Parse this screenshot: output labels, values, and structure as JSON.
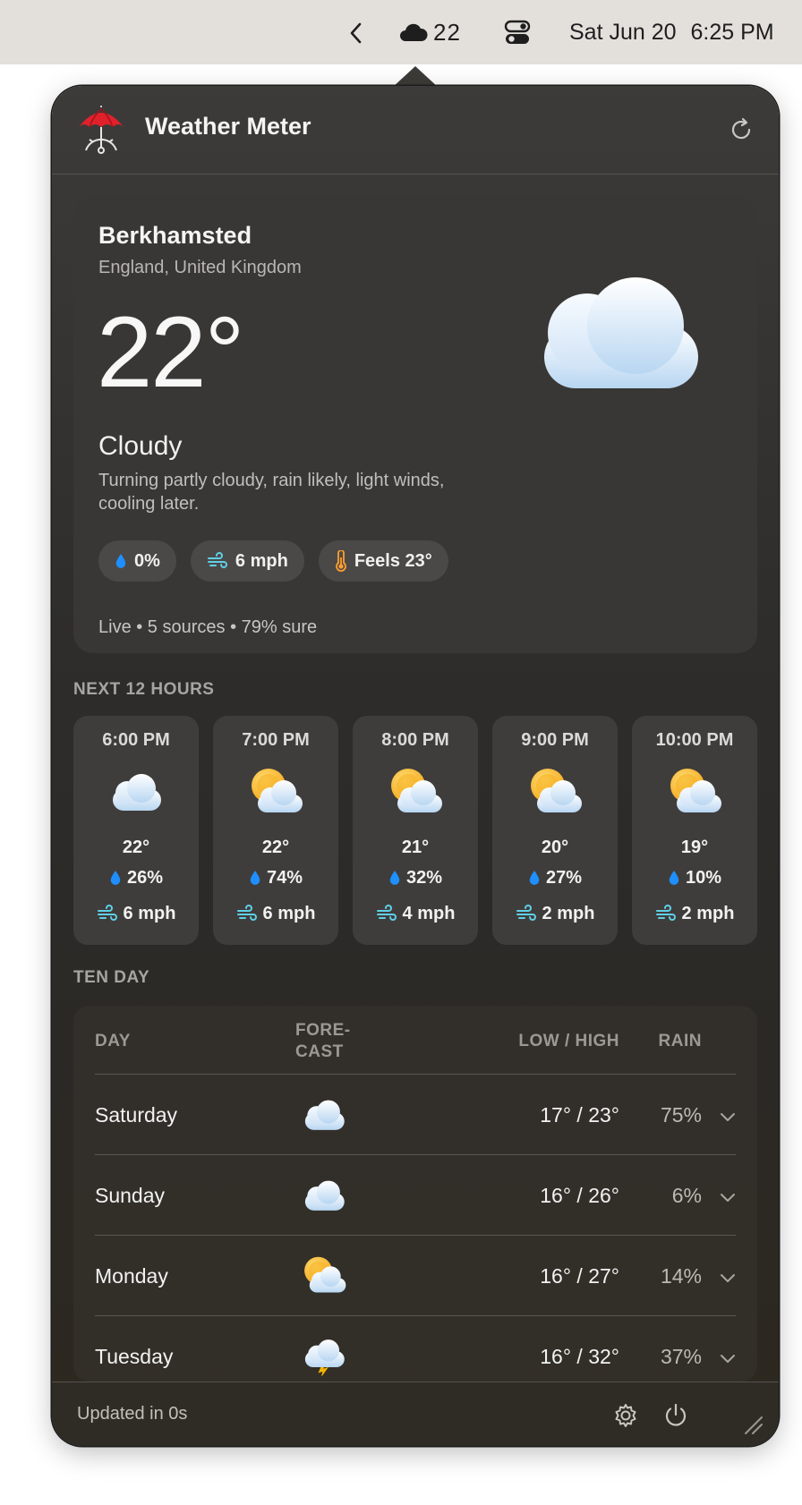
{
  "menubar": {
    "weather_temp": "22",
    "date": "Sat Jun 20",
    "time": "6:25 PM"
  },
  "app": {
    "title": "Weather Meter"
  },
  "current": {
    "city": "Berkhamsted",
    "region": "England, United Kingdom",
    "temperature": "22°",
    "condition": "Cloudy",
    "summary": "Turning partly cloudy, rain likely, light winds, cooling later.",
    "chips": {
      "rain": "0%",
      "wind": "6 mph",
      "feels": "Feels 23°"
    },
    "status": "Live • 5 sources • 79% sure"
  },
  "hourly_label": "NEXT 12 HOURS",
  "hourly": [
    {
      "time": "6:00 PM",
      "icon": "cloud",
      "temp": "22°",
      "rain": "26%",
      "wind": "6 mph"
    },
    {
      "time": "7:00 PM",
      "icon": "sun-behind-cloud",
      "temp": "22°",
      "rain": "74%",
      "wind": "6 mph"
    },
    {
      "time": "8:00 PM",
      "icon": "sun-behind-cloud",
      "temp": "21°",
      "rain": "32%",
      "wind": "4 mph"
    },
    {
      "time": "9:00 PM",
      "icon": "sun-behind-cloud",
      "temp": "20°",
      "rain": "27%",
      "wind": "2 mph"
    },
    {
      "time": "10:00 PM",
      "icon": "sun-behind-cloud",
      "temp": "19°",
      "rain": "10%",
      "wind": "2 mph"
    }
  ],
  "tenday_label": "TEN DAY",
  "tenday": {
    "headers": {
      "day": "DAY",
      "forecast_line1": "FORE-",
      "forecast_line2": "CAST",
      "lowhigh": "LOW / HIGH",
      "rain": "RAIN"
    },
    "rows": [
      {
        "day": "Saturday",
        "icon": "cloud",
        "lohi": "17° / 23°",
        "rain": "75%"
      },
      {
        "day": "Sunday",
        "icon": "cloud",
        "lohi": "16° / 26°",
        "rain": "6%"
      },
      {
        "day": "Monday",
        "icon": "sun-behind-cloud",
        "lohi": "16° / 27°",
        "rain": "14%"
      },
      {
        "day": "Tuesday",
        "icon": "thunder-cloud",
        "lohi": "16° / 32°",
        "rain": "37%"
      }
    ]
  },
  "footer": {
    "updated": "Updated in 0s"
  },
  "colors": {
    "rain_drop": "#1f8fff",
    "wind": "#5fd0e8",
    "thermometer": "#ff9f2e",
    "sun": "#f8b62c",
    "cloud": "#dce9f7"
  }
}
